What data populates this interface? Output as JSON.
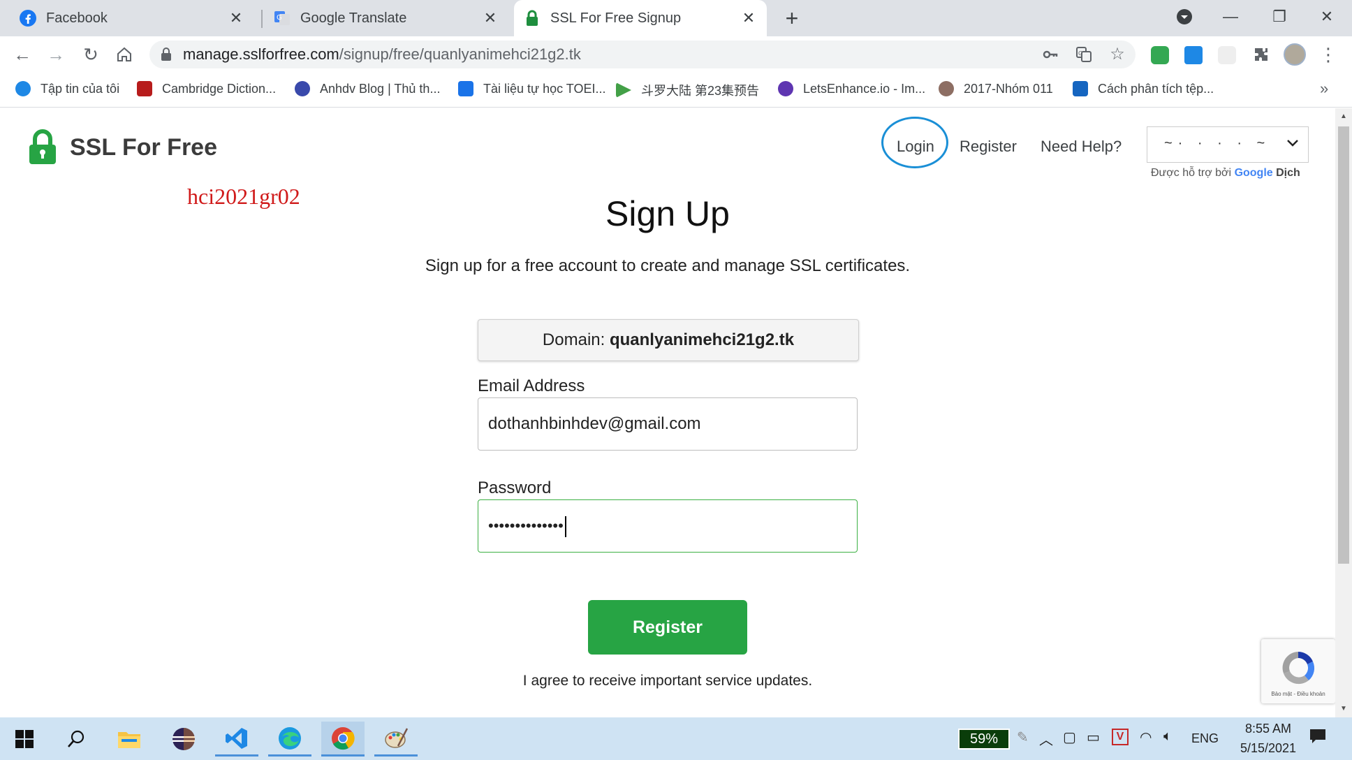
{
  "tabs": [
    {
      "title": "Facebook",
      "icon": "facebook-icon"
    },
    {
      "title": "Google Translate",
      "icon": "google-translate-icon"
    },
    {
      "title": "SSL For Free Signup",
      "icon": "lock-icon",
      "active": true
    }
  ],
  "address_bar": {
    "host": "manage.sslforfree.com",
    "path": "/signup/free/quanlyanimehci21g2.tk"
  },
  "bookmarks": [
    {
      "label": "Tập tin của tôi",
      "icon": "cloud-icon",
      "color": "#1e88e5"
    },
    {
      "label": "Cambridge Diction...",
      "icon": "cambridge-shield-icon",
      "color": "#b71c1c"
    },
    {
      "label": "Anhdv Blog | Thủ th...",
      "icon": "blog-a-icon",
      "color": "#3949ab"
    },
    {
      "label": "Tài liệu tự học TOEI...",
      "icon": "google-docs-icon",
      "color": "#1a73e8"
    },
    {
      "label": "斗罗大陆 第23集预告",
      "icon": "video-play-icon",
      "color": "#43a047"
    },
    {
      "label": "LetsEnhance.io - Im...",
      "icon": "letsenhance-icon",
      "color": "#5e35b1"
    },
    {
      "label": "2017-Nhóm 011",
      "icon": "avatar-icon",
      "color": "#8d6e63"
    },
    {
      "label": "Cách phân tích tệp...",
      "icon": "hashnode-h-icon",
      "color": "#1565c0"
    }
  ],
  "site": {
    "brand": "SSL For Free",
    "nav": {
      "login": "Login",
      "register": "Register",
      "help": "Need Help?"
    },
    "language_select": {
      "value": "~·  · · ·   ~"
    },
    "powered_by": {
      "prefix": "Được hỗ trợ bởi",
      "google": "Google",
      "translate": "Dịch"
    },
    "watermark": "hci2021gr02"
  },
  "form": {
    "heading": "Sign Up",
    "subheading": "Sign up for a free account to create and manage SSL certificates.",
    "domain_label": "Domain:",
    "domain_value": "quanlyanimehci21g2.tk",
    "email_label": "Email Address",
    "email_value": "dothanhbinhdev@gmail.com",
    "password_label": "Password",
    "password_value": "••••••••••••••",
    "submit_label": "Register",
    "agree_text": "I agree to receive important service updates."
  },
  "recaptcha": {
    "footer": "Bảo mật - Điều khoản"
  },
  "taskbar": {
    "battery_percent": "59%",
    "language": "ENG",
    "time": "8:55 AM",
    "date": "5/15/2021"
  },
  "colors": {
    "brand_green": "#27a444",
    "login_highlight": "#1a8fd6",
    "watermark_red": "#d01a1a"
  }
}
